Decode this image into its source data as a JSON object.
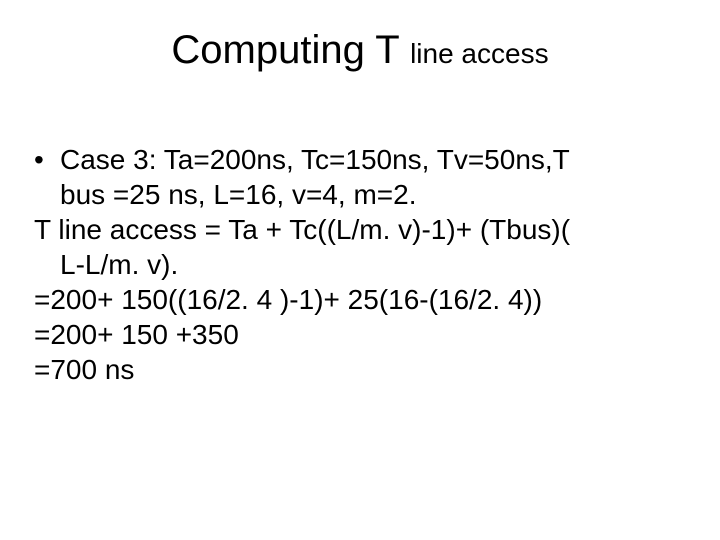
{
  "title": {
    "main": "Computing T ",
    "sub": "line access"
  },
  "lines": {
    "l1": "Case 3: Ta=200ns, Tc=150ns, Tv=50ns,T",
    "l2": "bus =25 ns, L=16, v=4, m=2.",
    "l3": "T line access = Ta + Tc((L/m. v)-1)+ (Tbus)(",
    "l4": "L-L/m. v).",
    "l5": "=200+ 150((16/2. 4 )-1)+ 25(16-(16/2. 4))",
    "l6": "=200+ 150 +350",
    "l7": "=700 ns"
  }
}
